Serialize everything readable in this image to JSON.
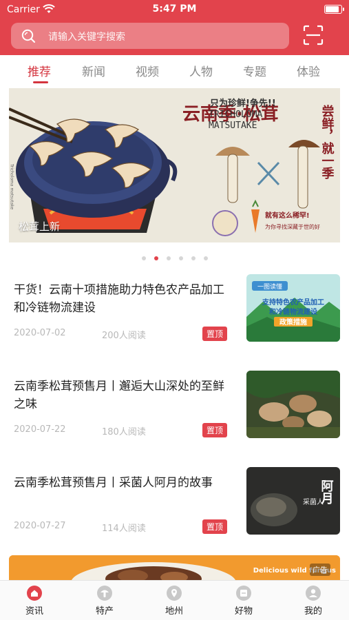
{
  "status": {
    "carrier": "Carrier",
    "time": "5:47 PM"
  },
  "search": {
    "placeholder": "请输入关键字搜索"
  },
  "tabs": [
    {
      "label": "推荐",
      "active": true
    },
    {
      "label": "新闻"
    },
    {
      "label": "视频"
    },
    {
      "label": "人物"
    },
    {
      "label": "专题"
    },
    {
      "label": "体验"
    }
  ],
  "banner": {
    "caption": "松茸上新",
    "headline_left": "云南季·松茸",
    "small_top": "只为珍鲜!争先!!",
    "latin_1": "TRICHOLOMA",
    "latin_2": "MATSUTAKE",
    "side_right": "尝鲜，就一季",
    "rare_line": "就有这么稀罕!",
    "bottom_line": "为你寻找深藏于世的好",
    "pan_side_text": "Tricholoma matsutake",
    "pages": 6,
    "active_page": 2
  },
  "articles": [
    {
      "title": "干货！云南十项措施助力特色农产品加工和冷链物流建设",
      "date": "2020-07-02",
      "reads": "200人阅读",
      "badge": "置顶",
      "thumb_tag": "一图读懂",
      "thumb_l1": "支持特色农产品加工",
      "thumb_l2": "和冷链物流建设",
      "thumb_l3": "政策措施"
    },
    {
      "title": "云南季松茸预售月丨邂逅大山深处的至鲜之味",
      "date": "2020-07-22",
      "reads": "180人阅读",
      "badge": "置顶"
    },
    {
      "title": "云南季松茸预售月丨采菌人阿月的故事",
      "date": "2020-07-27",
      "reads": "114人阅读",
      "badge": "置顶",
      "thumb_small": "采菌人",
      "thumb_big": "阿月"
    }
  ],
  "ad": {
    "text": "Delicious wild fungus",
    "tag": "广告"
  },
  "nav": [
    {
      "label": "资讯",
      "icon": "home-icon",
      "active": true
    },
    {
      "label": "特产",
      "icon": "specialty-icon"
    },
    {
      "label": "地州",
      "icon": "location-icon"
    },
    {
      "label": "好物",
      "icon": "goods-icon"
    },
    {
      "label": "我的",
      "icon": "profile-icon"
    }
  ],
  "colors": {
    "brand": "#e2434c",
    "text": "#222222",
    "muted": "#b8b8b8",
    "inactive_icon": "#c8c8c8"
  }
}
